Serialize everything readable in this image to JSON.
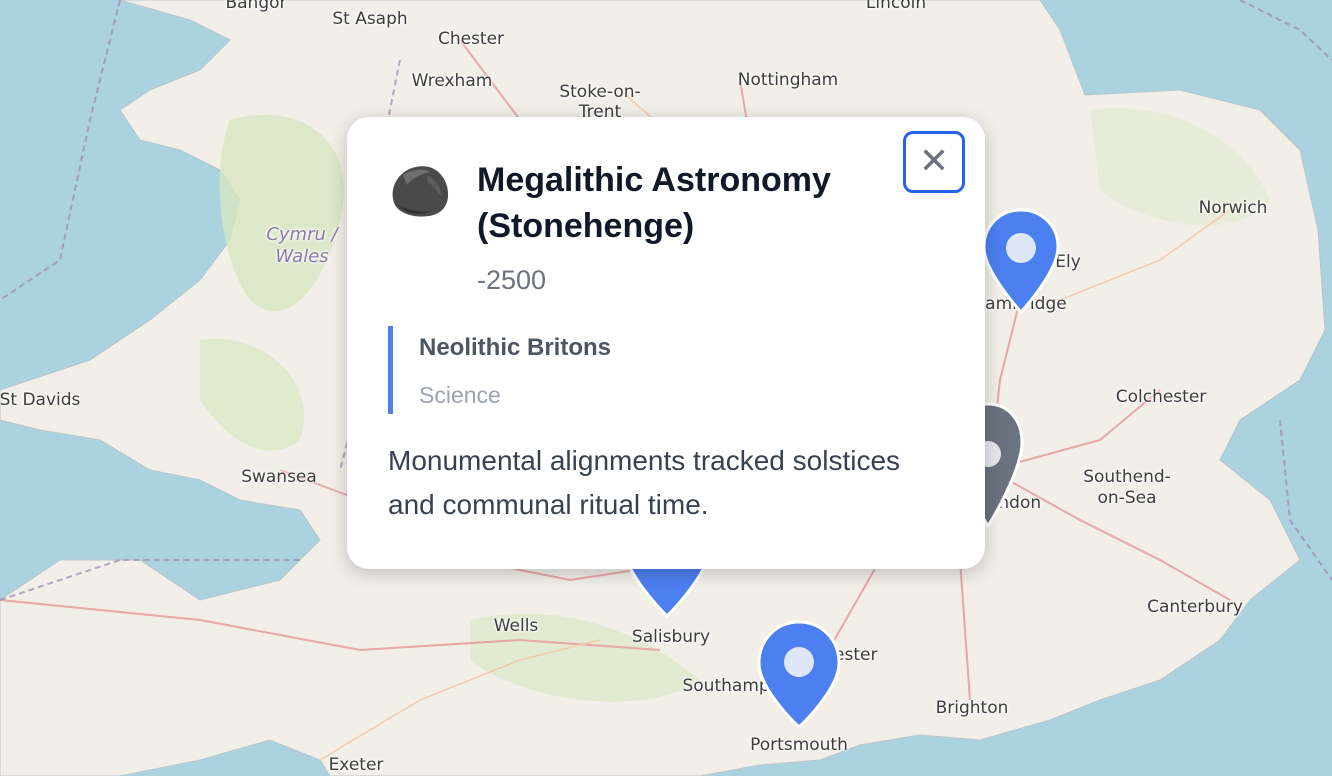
{
  "places": [
    {
      "name": "Bangor",
      "type": "town"
    },
    {
      "name": "St Asaph",
      "type": "town"
    },
    {
      "name": "Chester",
      "type": "town"
    },
    {
      "name": "Lincoln",
      "type": "town"
    },
    {
      "name": "Wrexham",
      "type": "town"
    },
    {
      "name": "Stoke-on-",
      "type": "town"
    },
    {
      "name": "Trent",
      "type": "town"
    },
    {
      "name": "Nottingham",
      "type": "town"
    },
    {
      "name": "Norwich",
      "type": "town"
    },
    {
      "name": "Ely",
      "type": "town"
    },
    {
      "name": "Cambridge",
      "type": "town"
    },
    {
      "name": "St Davids",
      "type": "town"
    },
    {
      "name": "Colchester",
      "type": "town"
    },
    {
      "name": "Swansea",
      "type": "town"
    },
    {
      "name": "Southend-",
      "type": "town"
    },
    {
      "name": "on-Sea",
      "type": "town"
    },
    {
      "name": "London",
      "type": "town"
    },
    {
      "name": "Canterbury",
      "type": "town"
    },
    {
      "name": "Wells",
      "type": "town"
    },
    {
      "name": "Salisbury",
      "type": "town"
    },
    {
      "name": "Chichester",
      "type": "town"
    },
    {
      "name": "Southampton",
      "type": "town"
    },
    {
      "name": "Brighton",
      "type": "town"
    },
    {
      "name": "Portsmouth",
      "type": "town"
    },
    {
      "name": "Exeter",
      "type": "town"
    }
  ],
  "region_label": {
    "line1": "Cymru /",
    "line2": "Wales"
  },
  "markers": [
    {
      "name": "cambridge-marker",
      "color": "#4c7ff0"
    },
    {
      "name": "london-marker",
      "color": "#6b7280"
    },
    {
      "name": "salisbury-marker",
      "color": "#4c7ff0"
    },
    {
      "name": "portsmouth-marker",
      "color": "#4c7ff0"
    }
  ],
  "popup": {
    "icon": "stone-icon",
    "title": "Megalithic Astronomy (Stonehenge)",
    "year": "-2500",
    "creator": "Neolithic Britons",
    "category": "Science",
    "description": "Monumental alignments tracked solstices and communal ritual time.",
    "close_icon": "close-icon"
  },
  "colors": {
    "sea": "#aad3df",
    "land": "#f2efe9",
    "accent": "#4c7ff0",
    "focus": "#2563eb"
  }
}
